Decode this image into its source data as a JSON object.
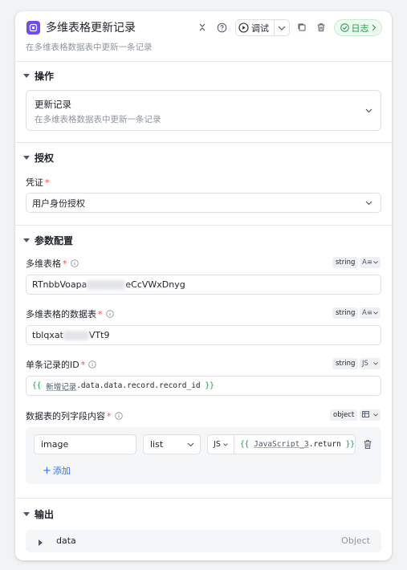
{
  "header": {
    "title": "多维表格更新记录",
    "subtitle": "在多维表格数据表中更新一条记录",
    "debug_label": "调试",
    "log_label": "日志"
  },
  "sections": {
    "operation": {
      "title": "操作",
      "selected_title": "更新记录",
      "selected_desc": "在多维表格数据表中更新一条记录"
    },
    "auth": {
      "title": "授权",
      "credential_label": "凭证",
      "credential_value": "用户身份授权"
    },
    "params": {
      "title": "参数配置",
      "fields": [
        {
          "label": "多维表格",
          "type": "string",
          "value_prefix": "RTnbbVoapa",
          "value_suffix": "eCcVWxDnyg"
        },
        {
          "label": "多维表格的数据表",
          "type": "string",
          "value_prefix": "tblqxat",
          "value_suffix": "VTt9"
        },
        {
          "label": "单条记录的ID",
          "type": "string",
          "mode": "JS",
          "expr_open": "{{",
          "expr_ref": "新增记录",
          "expr_path": ".data.data.record.record_id",
          "expr_close": "}}"
        },
        {
          "label": "数据表的列字段内容",
          "type": "object"
        }
      ],
      "mapping": {
        "name": "image",
        "kind": "list",
        "mode": "JS",
        "expr_open": "{{",
        "expr_ref": "JavaScript_3",
        "expr_path": ".return",
        "expr_close": "}}"
      },
      "add_label": "添加"
    },
    "output": {
      "title": "输出",
      "row_name": "data",
      "row_type": "Object"
    }
  },
  "colors": {
    "brand_icon": "#6e4bf5",
    "log_green": "#1a9b47",
    "required_red": "#f54a45",
    "link_blue": "#3370ff"
  }
}
